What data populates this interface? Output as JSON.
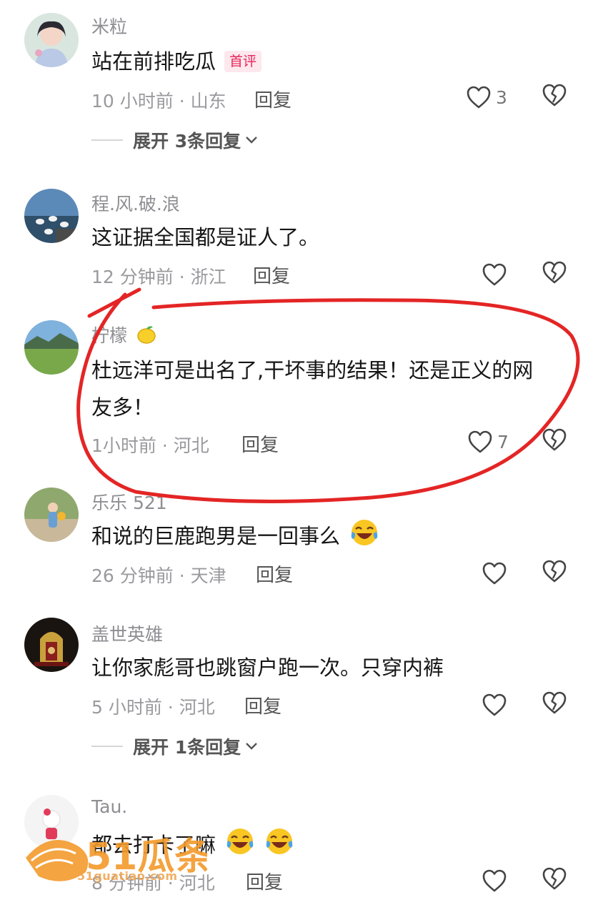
{
  "comments": [
    {
      "username": "米粒",
      "text": "站在前排吃瓜",
      "badge": "首评",
      "time_location": "10 小时前 · 山东",
      "reply_label": "回复",
      "likes": "3",
      "expand": "展开 3条回复"
    },
    {
      "username": "程.风.破.浪",
      "text": "这证据全国都是证人了。",
      "time_location": "12 分钟前 · 浙江",
      "reply_label": "回复",
      "likes": ""
    },
    {
      "username": "柠檬",
      "text_line1": "杜远洋可是出名了,干坏事的结果！还是正义的网",
      "text_line2": "友多！",
      "time_location": "1小时前 · 河北",
      "reply_label": "回复",
      "likes": "7"
    },
    {
      "username": "乐乐 521",
      "text": "和说的巨鹿跑男是一回事么",
      "time_location": "26 分钟前 · 天津",
      "reply_label": "回复",
      "likes": ""
    },
    {
      "username": "盖世英雄",
      "text": "让你家彪哥也跳窗户跑一次。只穿内裤",
      "time_location": "5 小时前 · 河北",
      "reply_label": "回复",
      "likes": "",
      "expand": "展开 1条回复"
    },
    {
      "username": "Tau.",
      "text": "都去打卡了嘛",
      "time_location": "8 分钟前 · 河北",
      "reply_label": "回复",
      "likes": ""
    }
  ],
  "watermark": {
    "brand": "51瓜条",
    "site": "51guatiao.com"
  },
  "colors": {
    "annotation_red": "#e42525",
    "badge_pink": "#e6265a",
    "watermark_orange": "#f39a2b"
  },
  "icons": [
    "heart-icon",
    "broken-heart-icon",
    "chevron-down-icon",
    "lemon-emoji",
    "laughing-crying-emoji"
  ]
}
